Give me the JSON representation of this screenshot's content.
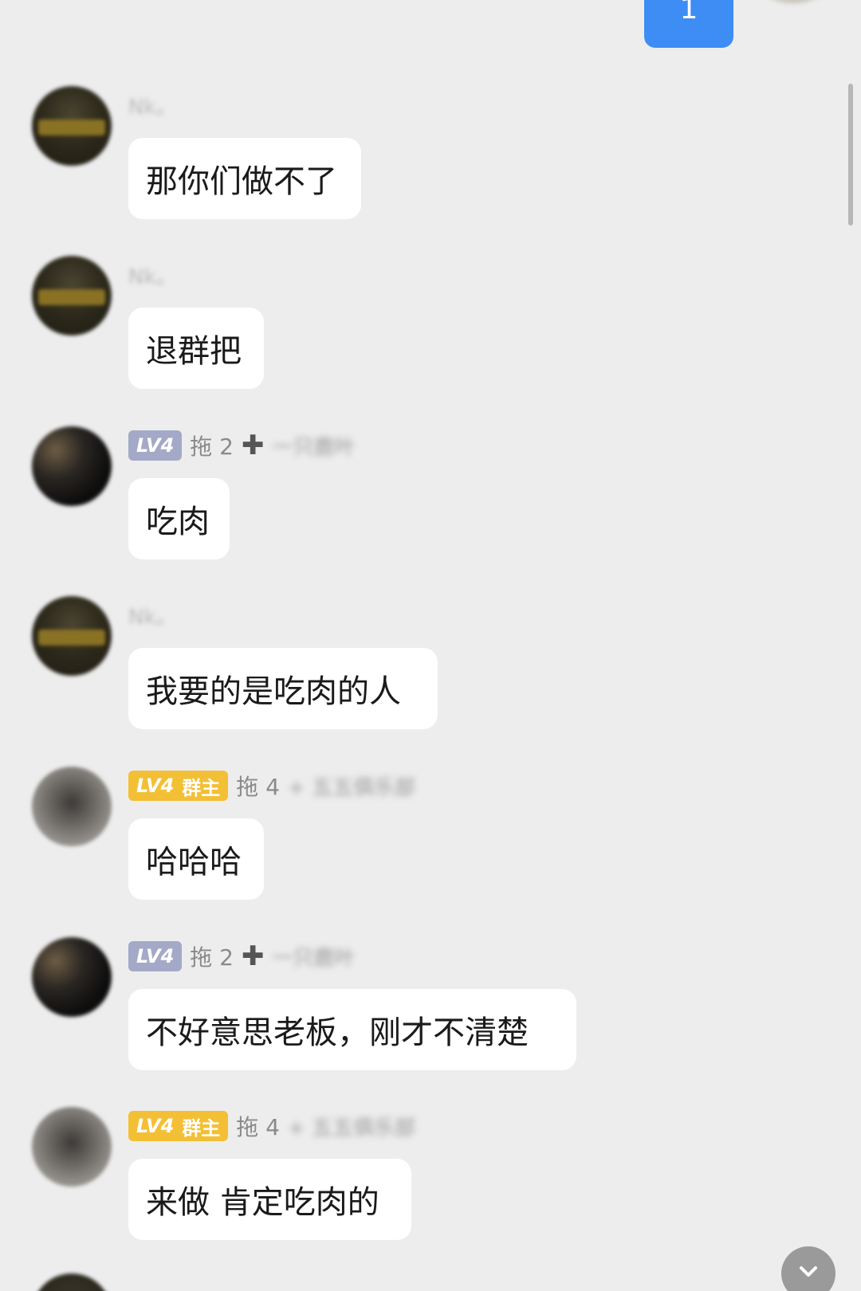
{
  "outgoing": {
    "text": "1",
    "color": "#3d8df5"
  },
  "messages": [
    {
      "id": "m1",
      "avatar": "gold-logo-avatar",
      "sender": {
        "name": "Nk。",
        "blurred": true
      },
      "text": "那你们做不了"
    },
    {
      "id": "m2",
      "avatar": "gold-logo-avatar",
      "sender": {
        "name": "Nk。",
        "blurred": true
      },
      "text": "退群把"
    },
    {
      "id": "m3",
      "avatar": "dark-photo-avatar",
      "sender": {
        "level": "LV4",
        "nickname": "拖 2",
        "has_plus": true,
        "blurred_suffix": "一只鹿叶"
      },
      "text": "吃肉"
    },
    {
      "id": "m4",
      "avatar": "gold-logo-avatar",
      "sender": {
        "name": "Nk。",
        "blurred": true
      },
      "text": "我要的是吃肉的人"
    },
    {
      "id": "m5",
      "avatar": "grey-photo-avatar",
      "sender": {
        "level": "LV4",
        "role": "群主",
        "nickname": "拖 4",
        "blurred_suffix": "+ 五五俱乐部"
      },
      "text": "哈哈哈"
    },
    {
      "id": "m6",
      "avatar": "dark-photo-avatar",
      "sender": {
        "level": "LV4",
        "nickname": "拖 2",
        "has_plus": true,
        "blurred_suffix": "一只鹿叶"
      },
      "text": "不好意思老板，刚才不清楚"
    },
    {
      "id": "m7",
      "avatar": "grey-photo-avatar",
      "sender": {
        "level": "LV4",
        "role": "群主",
        "nickname": "拖 4",
        "blurred_suffix": "+ 五五俱乐部"
      },
      "text": "来做 肯定吃肉的"
    }
  ],
  "controls": {
    "scroll_down_icon": "chevron-down-icon"
  },
  "colors": {
    "background": "#ededed",
    "bubble": "#ffffff",
    "level_badge": "#a3a9c7",
    "owner_badge": "#f3bf34"
  }
}
